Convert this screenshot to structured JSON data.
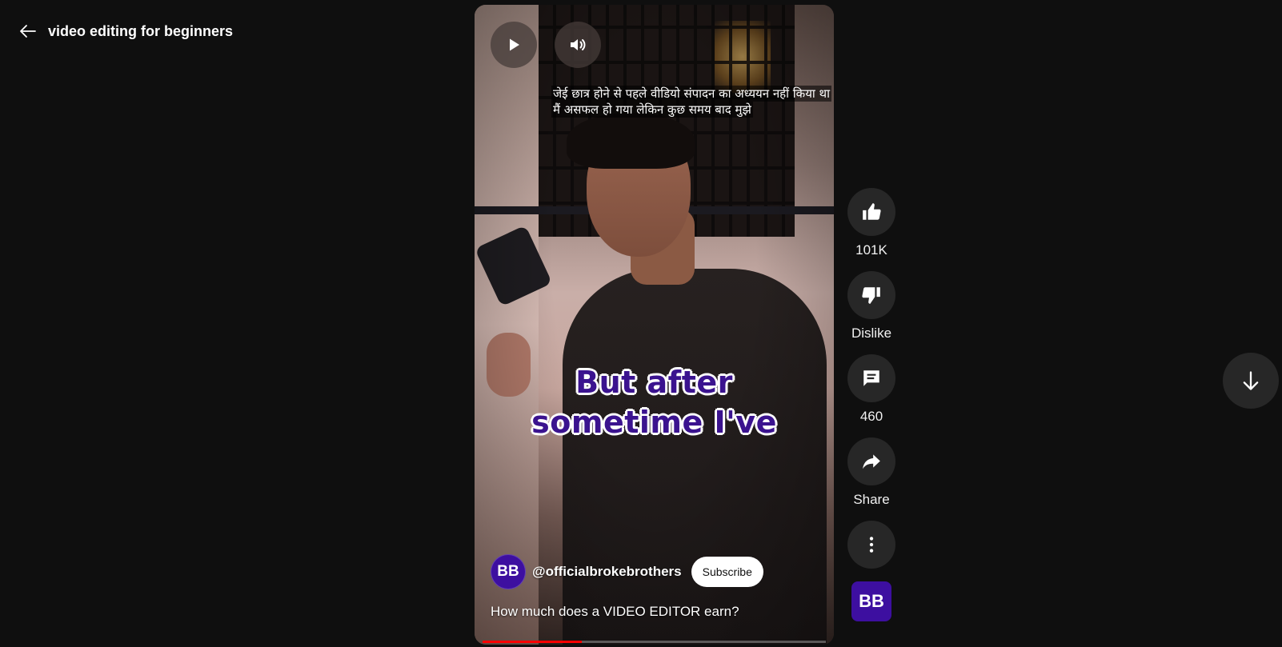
{
  "header": {
    "back_icon": "arrow-left-icon",
    "search_query": "video editing for beginners"
  },
  "player": {
    "play_icon": "play-icon",
    "volume_icon": "volume-icon",
    "subtitle_line_1": "जेई छात्र होने से पहले वीडियो संपादन का अध्ययन नहीं किया था",
    "subtitle_line_2": "मैं असफल हो गया लेकिन कुछ समय बाद  मुझे",
    "caption_line_1": "But after",
    "caption_line_2": "sometime I've",
    "caption_color": "#3b138f",
    "channel_avatar_text": "BB",
    "channel_handle": "@officialbrokebrothers",
    "subscribe_label": "Subscribe",
    "video_title": "How much does a VIDEO EDITOR earn?",
    "progress_percent": 29,
    "progress_color": "#ff0000"
  },
  "actions": {
    "like": {
      "icon": "thumbs-up-icon",
      "label": "101K"
    },
    "dislike": {
      "icon": "thumbs-down-icon",
      "label": "Dislike"
    },
    "comments": {
      "icon": "comment-icon",
      "label": "460"
    },
    "share": {
      "icon": "share-icon",
      "label": "Share"
    },
    "more": {
      "icon": "more-vertical-icon"
    },
    "channel_thumb_text": "BB"
  },
  "navigation": {
    "next_icon": "arrow-down-icon"
  },
  "colors": {
    "background": "#0f0f0f",
    "button_bg": "#272727",
    "channel_brand": "#3d0fa0"
  }
}
